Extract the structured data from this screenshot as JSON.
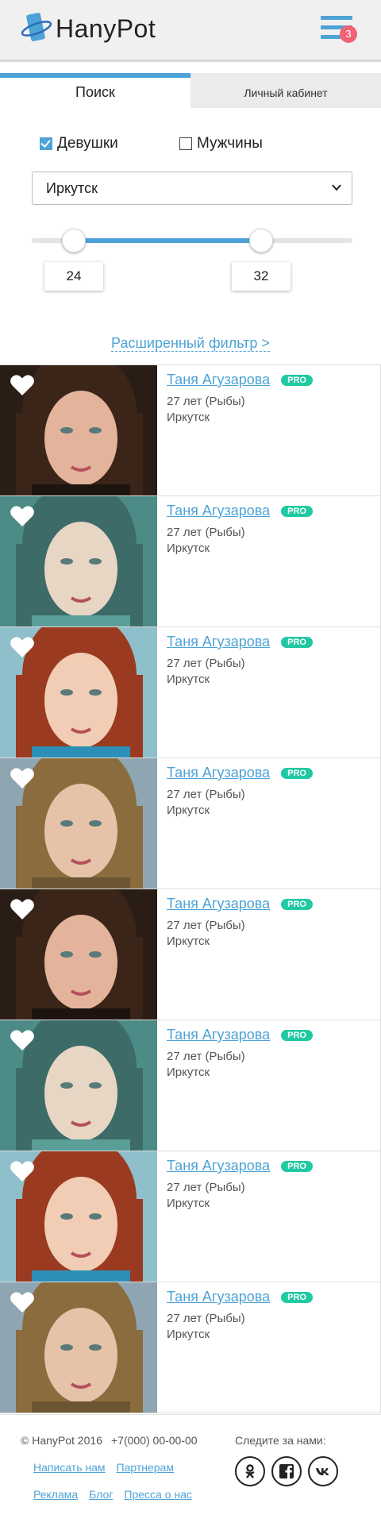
{
  "header": {
    "brand": "HanyPot",
    "notification_count": "3"
  },
  "tabs": [
    {
      "label": "Поиск",
      "active": true
    },
    {
      "label": "Личный кабинет",
      "active": false
    }
  ],
  "filters": {
    "gender": [
      {
        "label": "Девушки",
        "checked": true
      },
      {
        "label": "Мужчины",
        "checked": false
      }
    ],
    "city": "Иркутск",
    "age_from": "24",
    "age_to": "32",
    "extended_filter_label": "Расширенный фильтр >"
  },
  "profiles": [
    {
      "name": "Таня Агузарова",
      "badge": "PRO",
      "age": "27 лет (Рыбы)",
      "city": "Иркутск"
    },
    {
      "name": "Таня Агузарова",
      "badge": "PRO",
      "age": "27 лет (Рыбы)",
      "city": "Иркутск"
    },
    {
      "name": "Таня Агузарова",
      "badge": "PRO",
      "age": "27 лет (Рыбы)",
      "city": "Иркутск"
    },
    {
      "name": "Таня Агузарова",
      "badge": "PRO",
      "age": "27 лет (Рыбы)",
      "city": "Иркутск"
    },
    {
      "name": "Таня Агузарова",
      "badge": "PRO",
      "age": "27 лет (Рыбы)",
      "city": "Иркутск"
    },
    {
      "name": "Таня Агузарова",
      "badge": "PRO",
      "age": "27 лет (Рыбы)",
      "city": "Иркутск"
    },
    {
      "name": "Таня Агузарова",
      "badge": "PRO",
      "age": "27 лет (Рыбы)",
      "city": "Иркутск"
    },
    {
      "name": "Таня Агузарова",
      "badge": "PRO",
      "age": "27 лет (Рыбы)",
      "city": "Иркутск"
    }
  ],
  "footer": {
    "copyright": "© HanyPot 2016",
    "phone": "+7(000) 00-00-00",
    "follow_label": "Следите за нами:",
    "links_row1": [
      "Написать нам",
      "Партнерам"
    ],
    "links_row2": [
      "Реклама",
      "Блог",
      "Пресса о нас"
    ],
    "social_icons": [
      "odnoklassniki-icon",
      "facebook-icon",
      "vk-icon"
    ]
  },
  "colors": {
    "accent": "#4da3d6",
    "pro_badge": "#21c9a2",
    "notification": "#f16272"
  }
}
